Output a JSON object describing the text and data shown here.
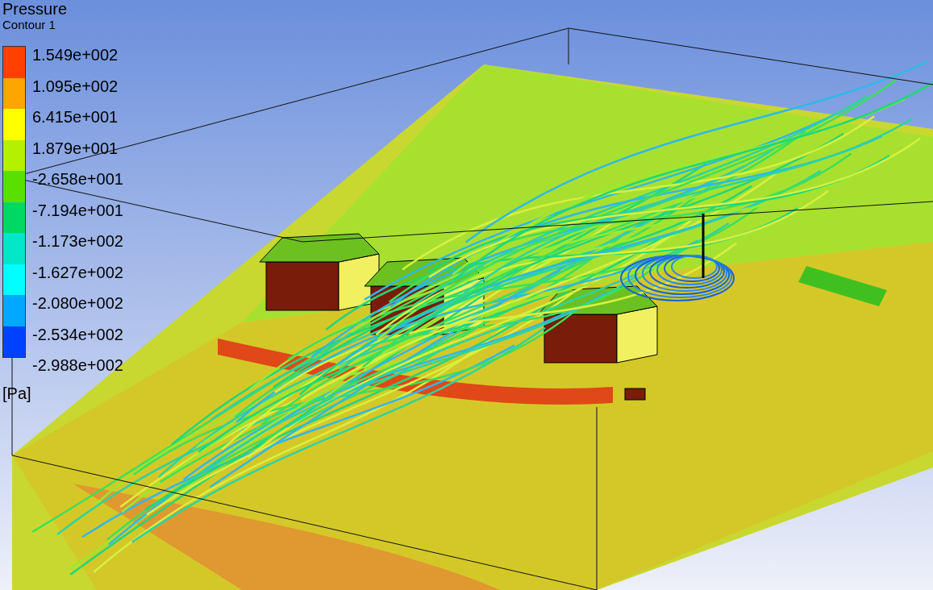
{
  "legend": {
    "title": "Pressure",
    "subtitle": "Contour 1",
    "bands": [
      {
        "color": "#ff4000"
      },
      {
        "color": "#ffa500"
      },
      {
        "color": "#ffff00"
      },
      {
        "color": "#b4f000"
      },
      {
        "color": "#5ae000"
      },
      {
        "color": "#00d864"
      },
      {
        "color": "#00e8c8"
      },
      {
        "color": "#00ffff"
      },
      {
        "color": "#00a8ff"
      },
      {
        "color": "#0040ff"
      }
    ],
    "labels": [
      "1.549e+002",
      "1.095e+002",
      "6.415e+001",
      "1.879e+001",
      "-2.658e+001",
      "-7.194e+001",
      "-1.173e+002",
      "-1.627e+002",
      "-2.080e+002",
      "-2.534e+002",
      "-2.988e+002"
    ],
    "unit": "[Pa]"
  }
}
